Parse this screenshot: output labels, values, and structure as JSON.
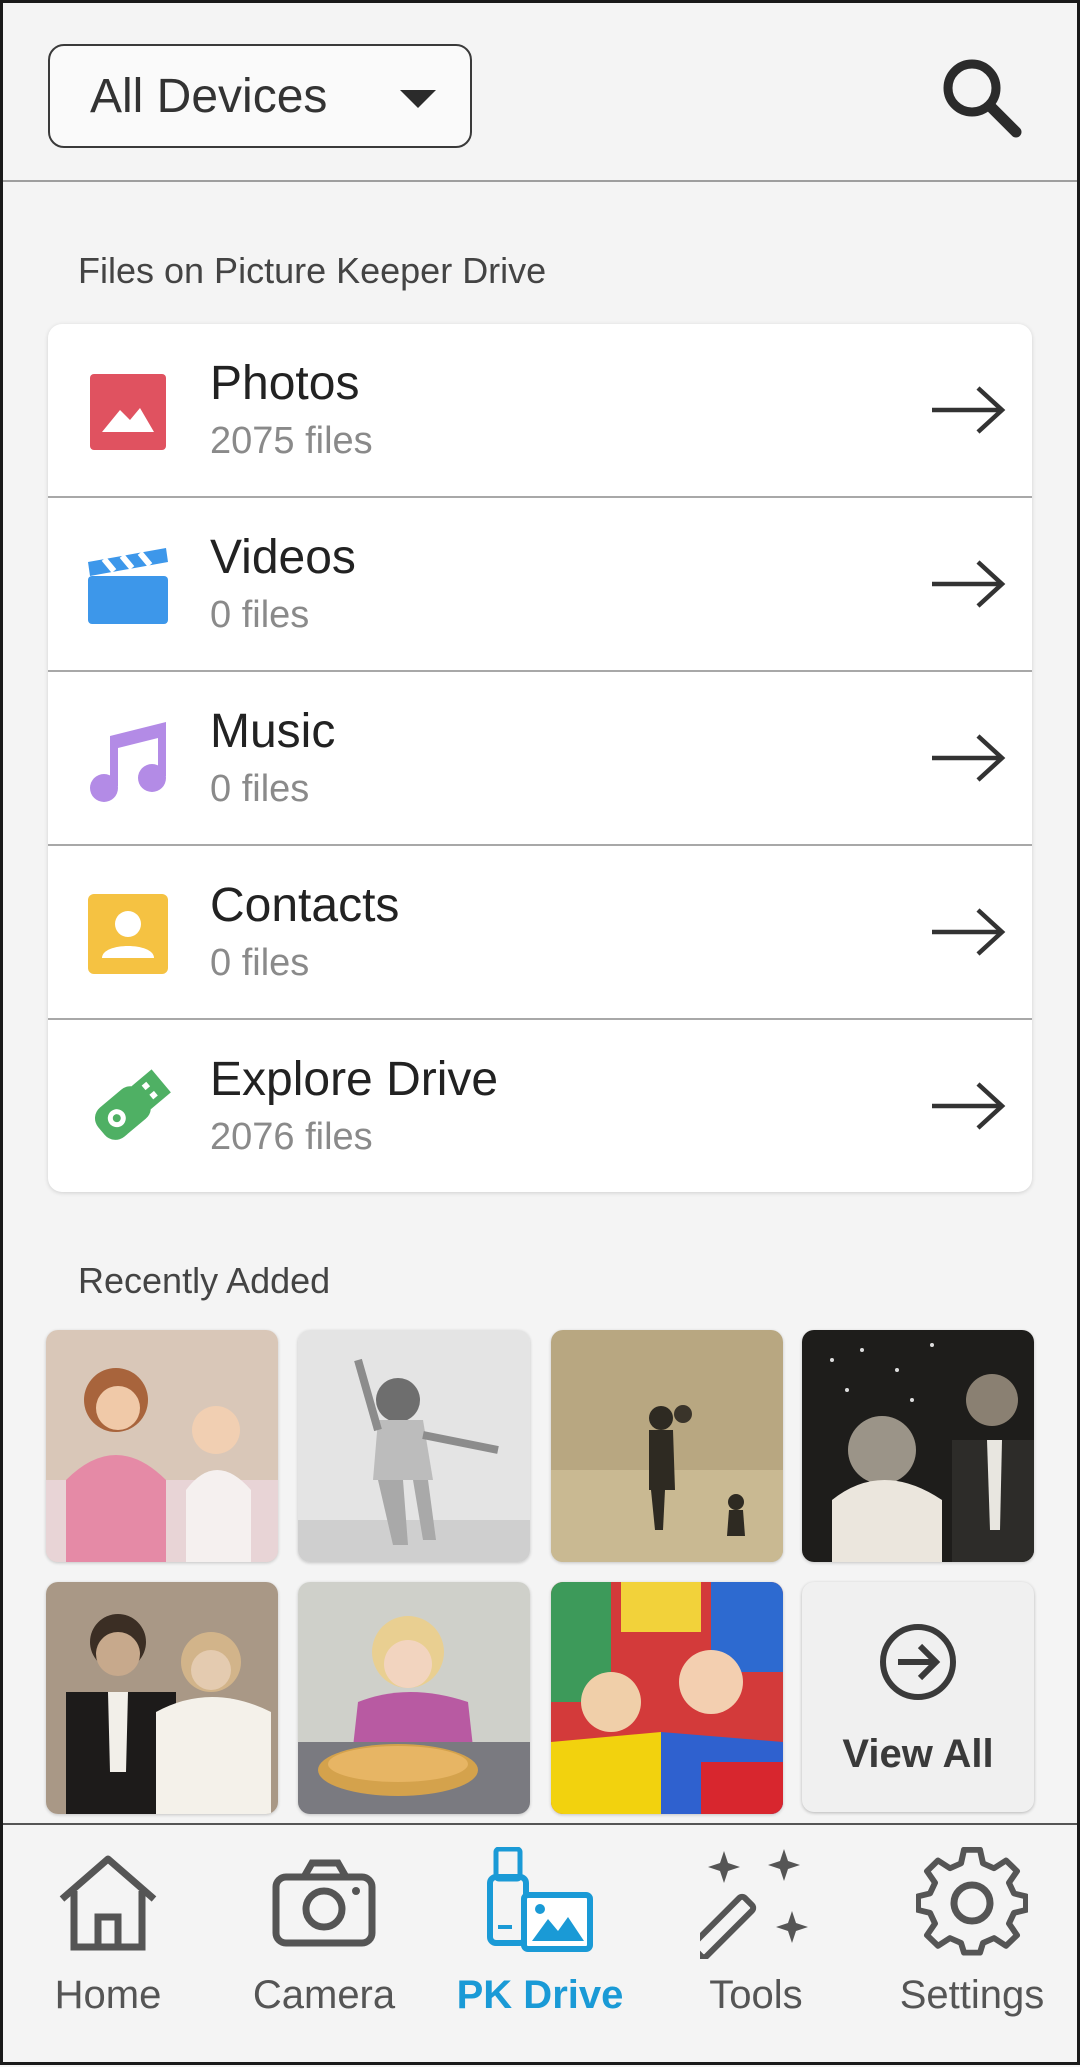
{
  "header": {
    "device_select_value": "All Devices"
  },
  "files_section": {
    "label": "Files on Picture Keeper Drive",
    "items": [
      {
        "title": "Photos",
        "count": "2075 files",
        "icon": "photo-icon",
        "color": "#e05260"
      },
      {
        "title": "Videos",
        "count": "0 files",
        "icon": "clapperboard-icon",
        "color": "#3d97ea"
      },
      {
        "title": "Music",
        "count": "0 files",
        "icon": "music-note-icon",
        "color": "#b38be6"
      },
      {
        "title": "Contacts",
        "count": "0 files",
        "icon": "contact-card-icon",
        "color": "#f5c242"
      },
      {
        "title": "Explore Drive",
        "count": "2076 files",
        "icon": "usb-drive-icon",
        "color": "#4fb064"
      }
    ]
  },
  "recent_section": {
    "label": "Recently Added",
    "view_all_label": "View All"
  },
  "nav": {
    "items": [
      {
        "label": "Home",
        "icon": "home-icon"
      },
      {
        "label": "Camera",
        "icon": "camera-icon"
      },
      {
        "label": "PK Drive",
        "icon": "pk-drive-icon",
        "active": true
      },
      {
        "label": "Tools",
        "icon": "magic-wand-icon"
      },
      {
        "label": "Settings",
        "icon": "gear-icon"
      }
    ],
    "active_color": "#1a9ad6"
  }
}
